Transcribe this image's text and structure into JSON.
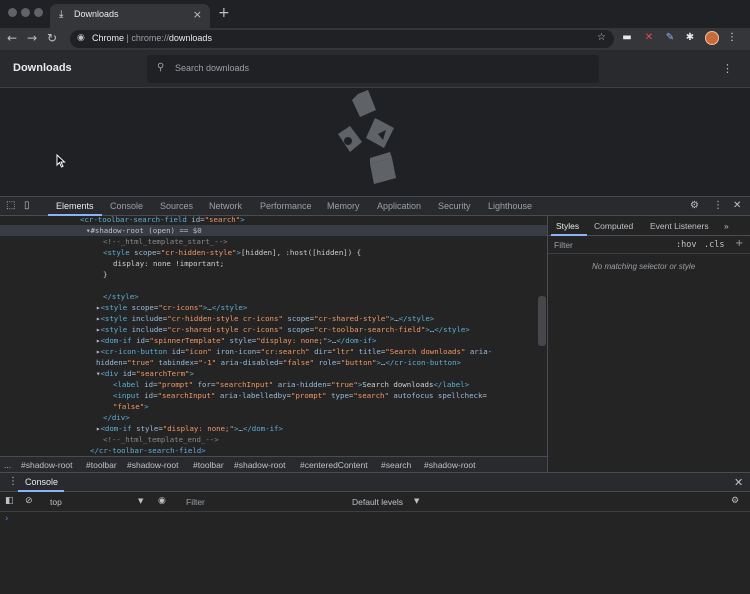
{
  "browser": {
    "tab_title": "Downloads",
    "new_tab_glyph": "+",
    "close_glyph": "×",
    "omnibox_site": "Chrome",
    "omnibox_sep": "|",
    "omnibox_url_prefix": "chrome://",
    "omnibox_url_host": "downloads",
    "icons": [
      "back-icon",
      "forward-icon",
      "reload-icon",
      "star-icon",
      "extensions-icon",
      "profile-avatar",
      "menu-icon"
    ]
  },
  "downloads": {
    "title": "Downloads",
    "search_placeholder": "Search downloads",
    "empty_illustration": "file-types-illustration"
  },
  "devtools": {
    "tabs": [
      "Elements",
      "Console",
      "Sources",
      "Network",
      "Performance",
      "Memory",
      "Application",
      "Security",
      "Lighthouse"
    ],
    "active_tab": "Elements",
    "breadcrumbs": [
      "...",
      "#shadow-root",
      "#toolbar",
      "#shadow-root",
      "#toolbar",
      "#shadow-root",
      "#centeredContent",
      "#search",
      "#shadow-root"
    ],
    "styles": {
      "tabs": [
        "Styles",
        "Computed",
        "Event Listeners",
        "»"
      ],
      "filter_placeholder": "Filter",
      "hov": ":hov",
      "cls": ".cls",
      "plus": "+",
      "empty": "No matching selector or style"
    },
    "drawer": {
      "tab": "Console",
      "context": "top",
      "filter_placeholder": "Filter",
      "levels": "Default levels",
      "prompt": "›"
    }
  },
  "colors": {
    "accent": "#8ab4f8",
    "tag": "#5db0d7",
    "attr": "#9bbbdc",
    "value": "#f29766",
    "comment": "#898989"
  }
}
